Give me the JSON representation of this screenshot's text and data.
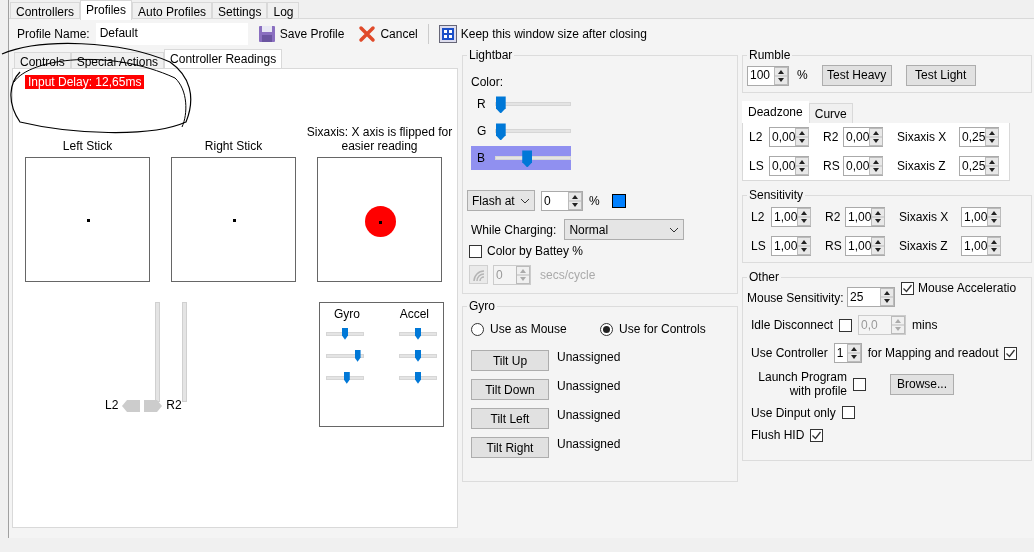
{
  "tabs": [
    {
      "label": "Controllers",
      "selected": false
    },
    {
      "label": "Profiles",
      "selected": true
    },
    {
      "label": "Auto Profiles",
      "selected": false
    },
    {
      "label": "Settings",
      "selected": false
    },
    {
      "label": "Log",
      "selected": false
    }
  ],
  "profile": {
    "label": "Profile Name:",
    "value": "Default"
  },
  "toolbar": [
    {
      "kind": "save",
      "label": "Save Profile"
    },
    {
      "kind": "cancel",
      "label": "Cancel"
    },
    {
      "kind": "window",
      "label": "Keep this window size after closing"
    }
  ],
  "sub_tabs": [
    {
      "label": "Controls",
      "selected": false
    },
    {
      "label": "Special Actions",
      "selected": false
    },
    {
      "label": "Controller Readings",
      "selected": true
    }
  ],
  "readings": {
    "input_delay": "Input Delay: 12,65ms",
    "left_stick": "Left Stick",
    "right_stick": "Right Stick",
    "sixaxis": "Sixaxis: X axis is flipped for easier reading",
    "l2": "L2",
    "r2": "R2",
    "gyro_label": "Gyro",
    "accel_label": "Accel",
    "gyro": [
      {
        "level": 0.5
      },
      {
        "level": 0.85
      },
      {
        "level": 0.55
      }
    ],
    "accel": [
      {
        "level": 0.5
      },
      {
        "level": 0.5
      },
      {
        "level": 0.5
      }
    ]
  },
  "lightbar": {
    "title": "Lightbar",
    "color_label": "Color:",
    "channels": [
      {
        "name": "R",
        "level": 0.06,
        "focused": false
      },
      {
        "name": "G",
        "level": 0.06,
        "focused": false
      },
      {
        "name": "B",
        "level": 0.42,
        "focused": true
      }
    ],
    "flash_mode": "Flash at",
    "flash_value": "0",
    "flash_unit": "%",
    "charging_label": "While Charging:",
    "charging_value": "Normal",
    "battery": {
      "label": "Color by Battey %",
      "checked": false
    },
    "cycle": {
      "value": "0",
      "unit": "secs/cycle",
      "disabled": true
    }
  },
  "gyro": {
    "title": "Gyro",
    "modes": [
      {
        "label": "Use as Mouse",
        "selected": false
      },
      {
        "label": "Use for Controls",
        "selected": true
      }
    ],
    "tilts": [
      {
        "button": "Tilt Up",
        "value": "Unassigned"
      },
      {
        "button": "Tilt Down",
        "value": "Unassigned"
      },
      {
        "button": "Tilt Left",
        "value": "Unassigned"
      },
      {
        "button": "Tilt Right",
        "value": "Unassigned"
      }
    ]
  },
  "rumble": {
    "title": "Rumble",
    "value": "100",
    "unit": "%",
    "buttons": [
      "Test Heavy",
      "Test Light"
    ]
  },
  "zone_tabs": [
    {
      "label": "Deadzone",
      "selected": true
    },
    {
      "label": "Curve",
      "selected": false
    }
  ],
  "deadzone": [
    {
      "label": "L2",
      "value": "0,00"
    },
    {
      "label": "R2",
      "value": "0,00"
    },
    {
      "label": "Sixaxis X",
      "value": "0,25"
    },
    {
      "label": "LS",
      "value": "0,00"
    },
    {
      "label": "RS",
      "value": "0,00"
    },
    {
      "label": "Sixaxis Z",
      "value": "0,25"
    }
  ],
  "sensitivity": {
    "title": "Sensitivity",
    "fields": [
      {
        "label": "L2",
        "value": "1,00"
      },
      {
        "label": "R2",
        "value": "1,00"
      },
      {
        "label": "Sixaxis X",
        "value": "1,00"
      },
      {
        "label": "LS",
        "value": "1,00"
      },
      {
        "label": "RS",
        "value": "1,00"
      },
      {
        "label": "Sixaxis Z",
        "value": "1,00"
      }
    ]
  },
  "other": {
    "title": "Other",
    "mouse_sensitivity_label": "Mouse Sensitivity:",
    "mouse_sensitivity": "25",
    "acceleration": {
      "label": "Mouse Acceleratio",
      "checked": true
    },
    "idle": {
      "label": "Idle Disconnect",
      "checked": false,
      "value": "0,0",
      "unit": "mins",
      "disabled": true
    },
    "controller": {
      "label": "Use Controller",
      "value": "1",
      "suffix": "for Mapping and readout",
      "checked": true
    },
    "launch": {
      "label": "Launch Program with profile",
      "checked": false,
      "button": "Browse..."
    },
    "dinput": {
      "label": "Use Dinput only",
      "checked": false
    },
    "flush": {
      "label": "Flush HID",
      "checked": true
    }
  }
}
